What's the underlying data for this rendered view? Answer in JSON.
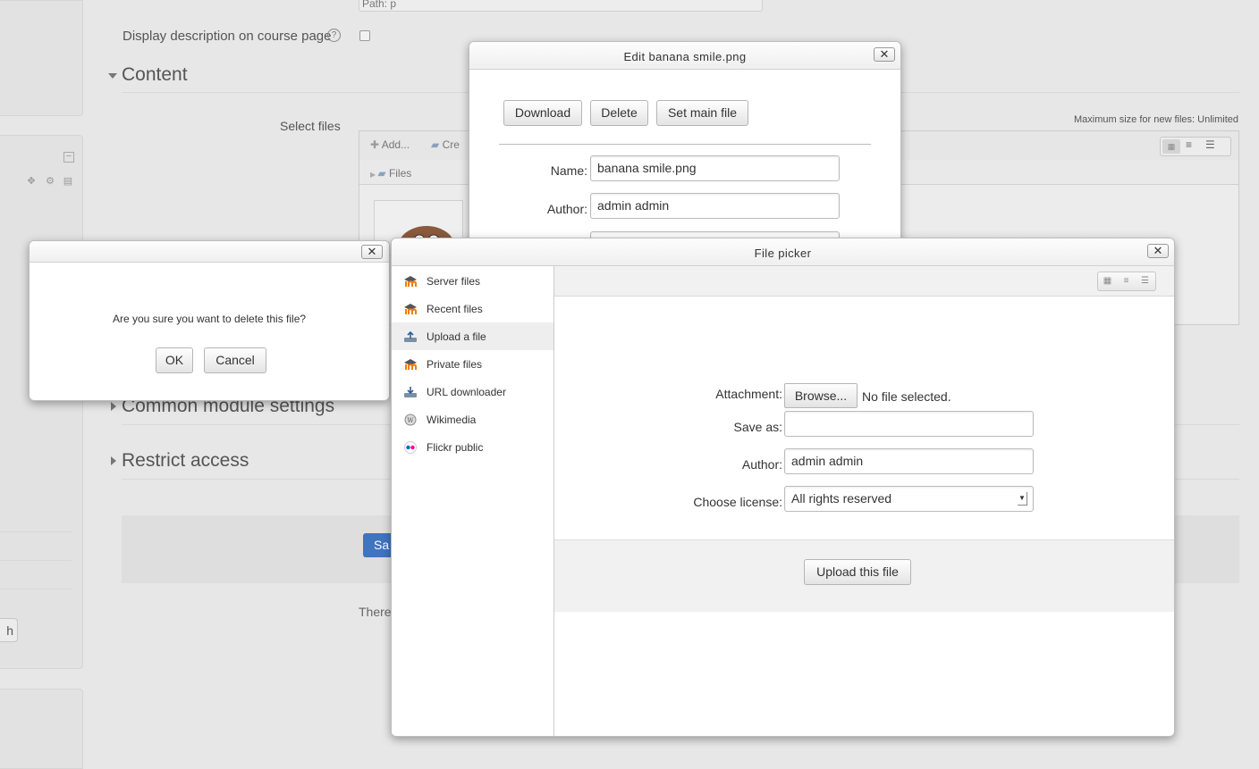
{
  "background": {
    "textarea_text": "Path: p",
    "display_description_label": "Display description on course page",
    "help_glyph": "?",
    "sections": {
      "content": "Content",
      "common": "Common module settings",
      "restrict": "Restrict access"
    },
    "select_files_label": "Select files",
    "max_size_text": "Maximum size for new files: Unlimited",
    "add_label": "Add...",
    "create_label": "Cre",
    "files_folder_label": "Files",
    "save_button_partial": "Sa",
    "there_text_partial": "There",
    "search_stub_glyph": "h"
  },
  "edit_dialog": {
    "title": "Edit banana smile.png",
    "close_glyph": "✕",
    "buttons": {
      "download": "Download",
      "delete": "Delete",
      "set_main": "Set main file"
    },
    "name_label": "Name:",
    "name_value": "banana smile.png",
    "author_label": "Author:",
    "author_value": "admin admin"
  },
  "confirm_dialog": {
    "close_glyph": "✕",
    "message": "Are you sure you want to delete this file?",
    "ok_label": "OK",
    "cancel_label": "Cancel"
  },
  "file_picker": {
    "title": "File picker",
    "close_glyph": "✕",
    "repositories": [
      {
        "label": "Server files",
        "icon": "moodle-icon"
      },
      {
        "label": "Recent files",
        "icon": "moodle-icon"
      },
      {
        "label": "Upload a file",
        "icon": "upload-icon",
        "active": true
      },
      {
        "label": "Private files",
        "icon": "moodle-icon"
      },
      {
        "label": "URL downloader",
        "icon": "url-downloader-icon"
      },
      {
        "label": "Wikimedia",
        "icon": "wikimedia-icon"
      },
      {
        "label": "Flickr public",
        "icon": "flickr-icon"
      }
    ],
    "attachment_label": "Attachment:",
    "browse_label": "Browse...",
    "no_file_text": "No file selected.",
    "save_as_label": "Save as:",
    "save_as_value": "",
    "author_label": "Author:",
    "author_value": "admin admin",
    "license_label": "Choose license:",
    "license_value": "All rights reserved",
    "upload_button": "Upload this file"
  }
}
